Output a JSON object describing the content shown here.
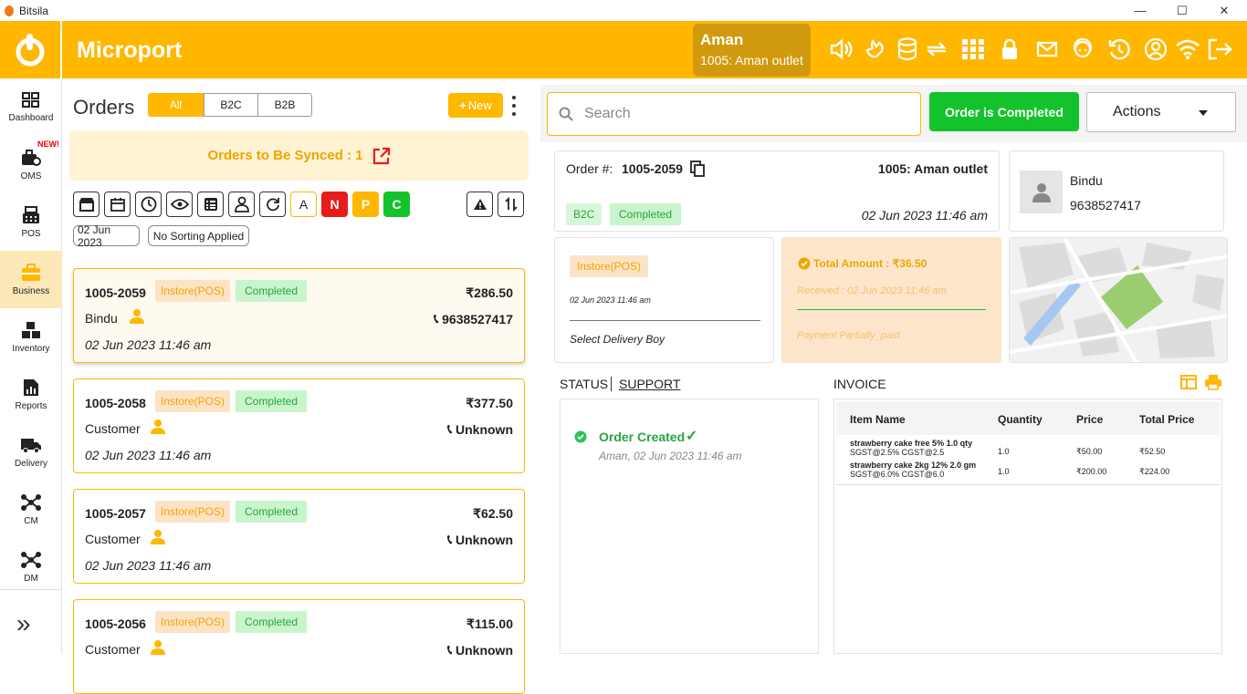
{
  "window": {
    "title": "Bitsila",
    "minimize": "—",
    "maximize": "☐",
    "close": "✕"
  },
  "header": {
    "brand": "Microport",
    "user_name": "Aman",
    "outlet": "1005: Aman outlet",
    "icons": [
      "volume-icon",
      "bird-icon",
      "database-icon",
      "sync-icon",
      "grid-icon",
      "lock-icon",
      "mail-icon",
      "support-icon",
      "history-icon",
      "profile-icon",
      "wifi-icon",
      "logout-icon"
    ]
  },
  "sidebar": {
    "items": [
      {
        "label": "Dashboard",
        "icon": "dashboard-icon"
      },
      {
        "label": "OMS",
        "icon": "oms-icon",
        "badge": "NEW!"
      },
      {
        "label": "POS",
        "icon": "pos-icon"
      },
      {
        "label": "Business",
        "icon": "briefcase-icon"
      },
      {
        "label": "Inventory",
        "icon": "inventory-icon"
      },
      {
        "label": "Reports",
        "icon": "reports-icon"
      },
      {
        "label": "Delivery",
        "icon": "truck-icon"
      },
      {
        "label": "CM",
        "icon": "network-icon"
      },
      {
        "label": "DM",
        "icon": "network-icon"
      }
    ],
    "expand": "»"
  },
  "orders": {
    "title": "Orders",
    "segments": [
      "All",
      "B2C",
      "B2B"
    ],
    "new_label": "New",
    "sync_text": "Orders to Be Synced : 1",
    "filters": [
      "A",
      "N",
      "P",
      "C"
    ],
    "chips": [
      "02 Jun 2023",
      "No Sorting Applied"
    ],
    "list": [
      {
        "id": "1005-2059",
        "source": "Instore(POS)",
        "status": "Completed",
        "amount": "₹286.50",
        "customer": "Bindu",
        "phone": "9638527417",
        "date": "02 Jun 2023 11:46 am"
      },
      {
        "id": "1005-2058",
        "source": "Instore(POS)",
        "status": "Completed",
        "amount": "₹377.50",
        "customer": "Customer",
        "phone": "Unknown",
        "date": "02 Jun 2023 11:46 am"
      },
      {
        "id": "1005-2057",
        "source": "Instore(POS)",
        "status": "Completed",
        "amount": "₹62.50",
        "customer": "Customer",
        "phone": "Unknown",
        "date": "02 Jun 2023 11:46 am"
      },
      {
        "id": "1005-2056",
        "source": "Instore(POS)",
        "status": "Completed",
        "amount": "₹115.00",
        "customer": "Customer",
        "phone": "Unknown",
        "date": ""
      }
    ]
  },
  "detail": {
    "search_placeholder": "Search",
    "complete_button": "Order is Completed",
    "actions_label": "Actions",
    "order_label": "Order #:",
    "order_id": "1005-2059",
    "outlet": "1005: Aman outlet",
    "type_badge": "B2C",
    "status_badge": "Completed",
    "order_date": "02 Jun 2023 11:46 am",
    "customer_name": "Bindu",
    "customer_phone": "9638527417",
    "source": "Instore(POS)",
    "source_date": "02 Jun 2023 11:46 am",
    "delivery_boy": "Select Delivery Boy",
    "total_amount": "Total Amount : ₹36.50",
    "received": "Received : 02 Jun 2023 11:46 am",
    "payment": "Payment Partially_paid",
    "status_tab": "STATUS",
    "support_tab": "SUPPORT",
    "timeline_title": "Order Created",
    "timeline_sub": "Aman, 02 Jun 2023 11:46 am",
    "invoice_title": "INVOICE",
    "invoice_headers": [
      "Item Name",
      "Quantity",
      "Price",
      "Total Price"
    ],
    "invoice_rows": [
      {
        "name": "strawberry cake free 5% 1.0 qty",
        "tax": "SGST@2.5% CGST@2.5",
        "qty": "1.0",
        "price": "₹50.00",
        "total": "₹52.50"
      },
      {
        "name": "strawberry cake 2kg 12% 2.0 gm",
        "tax": "SGST@6.0% CGST@6.0",
        "qty": "1.0",
        "price": "₹200.00",
        "total": "₹224.00"
      }
    ]
  },
  "colors": {
    "accent": "#ffb700",
    "success": "#14c32b",
    "danger": "#e81c1c"
  }
}
